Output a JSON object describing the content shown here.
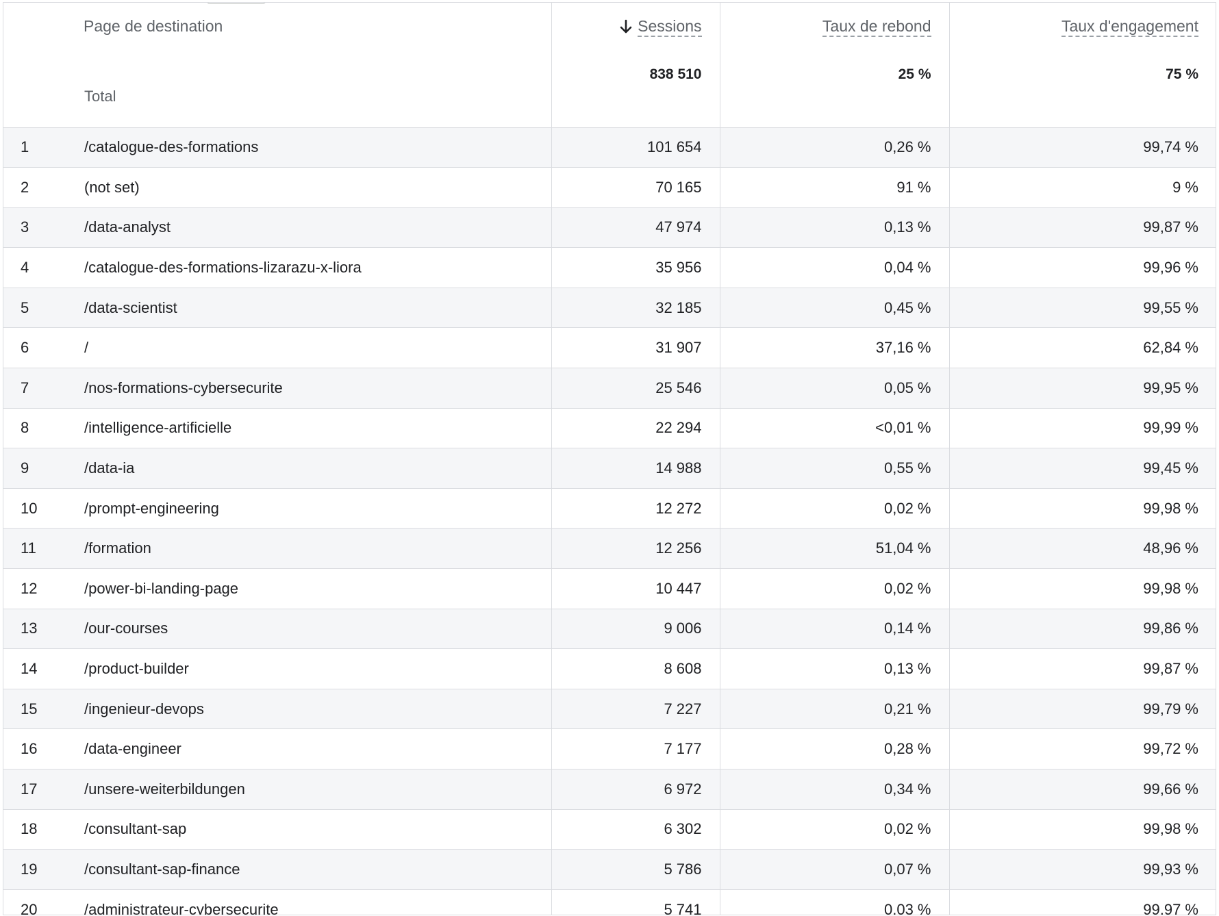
{
  "table": {
    "columns": {
      "page": "Page de destination",
      "sessions": "Sessions",
      "bounce_rate": "Taux de rebond",
      "engagement_rate": "Taux d'engagement"
    },
    "sort_indicator": "sort-descending-arrow-icon",
    "totals": {
      "label": "Total",
      "sessions": "838 510",
      "bounce_rate": "25 %",
      "engagement_rate": "75 %"
    },
    "rows": [
      {
        "index": "1",
        "page": "/catalogue-des-formations",
        "sessions": "101 654",
        "bounce_rate": "0,26 %",
        "engagement_rate": "99,74 %"
      },
      {
        "index": "2",
        "page": "(not set)",
        "sessions": "70 165",
        "bounce_rate": "91 %",
        "engagement_rate": "9 %"
      },
      {
        "index": "3",
        "page": "/data-analyst",
        "sessions": "47 974",
        "bounce_rate": "0,13 %",
        "engagement_rate": "99,87 %"
      },
      {
        "index": "4",
        "page": "/catalogue-des-formations-lizarazu-x-liora",
        "sessions": "35 956",
        "bounce_rate": "0,04 %",
        "engagement_rate": "99,96 %"
      },
      {
        "index": "5",
        "page": "/data-scientist",
        "sessions": "32 185",
        "bounce_rate": "0,45 %",
        "engagement_rate": "99,55 %"
      },
      {
        "index": "6",
        "page": "/",
        "sessions": "31 907",
        "bounce_rate": "37,16 %",
        "engagement_rate": "62,84 %"
      },
      {
        "index": "7",
        "page": "/nos-formations-cybersecurite",
        "sessions": "25 546",
        "bounce_rate": "0,05 %",
        "engagement_rate": "99,95 %"
      },
      {
        "index": "8",
        "page": "/intelligence-artificielle",
        "sessions": "22 294",
        "bounce_rate": "<0,01 %",
        "engagement_rate": "99,99 %"
      },
      {
        "index": "9",
        "page": "/data-ia",
        "sessions": "14 988",
        "bounce_rate": "0,55 %",
        "engagement_rate": "99,45 %"
      },
      {
        "index": "10",
        "page": "/prompt-engineering",
        "sessions": "12 272",
        "bounce_rate": "0,02 %",
        "engagement_rate": "99,98 %"
      },
      {
        "index": "11",
        "page": "/formation",
        "sessions": "12 256",
        "bounce_rate": "51,04 %",
        "engagement_rate": "48,96 %"
      },
      {
        "index": "12",
        "page": "/power-bi-landing-page",
        "sessions": "10 447",
        "bounce_rate": "0,02 %",
        "engagement_rate": "99,98 %"
      },
      {
        "index": "13",
        "page": "/our-courses",
        "sessions": "9 006",
        "bounce_rate": "0,14 %",
        "engagement_rate": "99,86 %"
      },
      {
        "index": "14",
        "page": "/product-builder",
        "sessions": "8 608",
        "bounce_rate": "0,13 %",
        "engagement_rate": "99,87 %"
      },
      {
        "index": "15",
        "page": "/ingenieur-devops",
        "sessions": "7 227",
        "bounce_rate": "0,21 %",
        "engagement_rate": "99,79 %"
      },
      {
        "index": "16",
        "page": "/data-engineer",
        "sessions": "7 177",
        "bounce_rate": "0,28 %",
        "engagement_rate": "99,72 %"
      },
      {
        "index": "17",
        "page": "/unsere-weiterbildungen",
        "sessions": "6 972",
        "bounce_rate": "0,34 %",
        "engagement_rate": "99,66 %"
      },
      {
        "index": "18",
        "page": "/consultant-sap",
        "sessions": "6 302",
        "bounce_rate": "0,02 %",
        "engagement_rate": "99,98 %"
      },
      {
        "index": "19",
        "page": "/consultant-sap-finance",
        "sessions": "5 786",
        "bounce_rate": "0,07 %",
        "engagement_rate": "99,93 %"
      },
      {
        "index": "20",
        "page": "/administrateur-cybersecurite",
        "sessions": "5 741",
        "bounce_rate": "0,03 %",
        "engagement_rate": "99,97 %"
      }
    ]
  }
}
